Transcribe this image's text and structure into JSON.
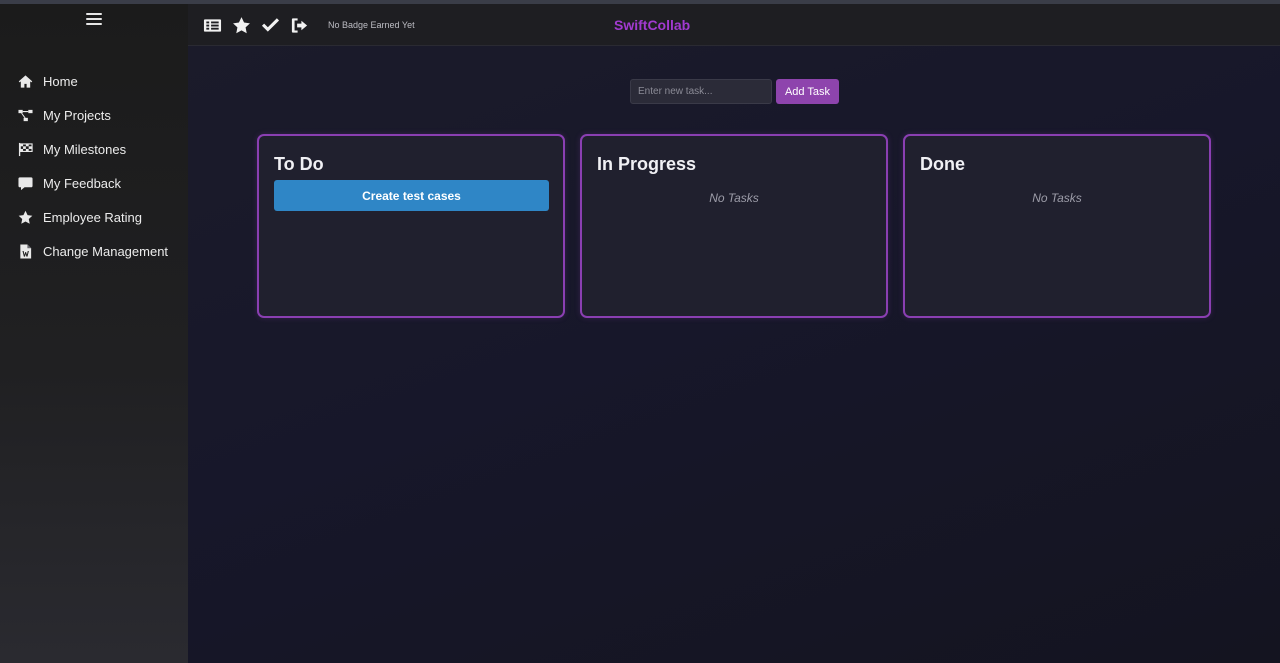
{
  "app": {
    "brand": "SwiftCollab"
  },
  "topbar": {
    "icons": [
      "list-icon",
      "star-icon",
      "check-icon",
      "logout-icon"
    ],
    "badge_text": "No Badge Earned Yet"
  },
  "sidebar": {
    "items": [
      {
        "label": "Home",
        "icon": "home-icon"
      },
      {
        "label": "My Projects",
        "icon": "project-tree-icon"
      },
      {
        "label": "My Milestones",
        "icon": "checkered-flag-icon"
      },
      {
        "label": "My Feedback",
        "icon": "comment-icon"
      },
      {
        "label": "Employee Rating",
        "icon": "star-icon"
      },
      {
        "label": "Change Management",
        "icon": "word-file-icon"
      }
    ]
  },
  "task_form": {
    "placeholder": "Enter new task...",
    "value": "",
    "add_label": "Add Task"
  },
  "board": {
    "columns": [
      {
        "title": "To Do",
        "tasks": [
          "Create test cases"
        ]
      },
      {
        "title": "In Progress",
        "tasks": [],
        "empty_text": "No Tasks"
      },
      {
        "title": "Done",
        "tasks": [],
        "empty_text": "No Tasks"
      }
    ]
  },
  "colors": {
    "brand": "#a23ad0",
    "accent_purple": "#8e44ad",
    "task_blue": "#2f86c6",
    "column_border": "#8a3fb2"
  }
}
